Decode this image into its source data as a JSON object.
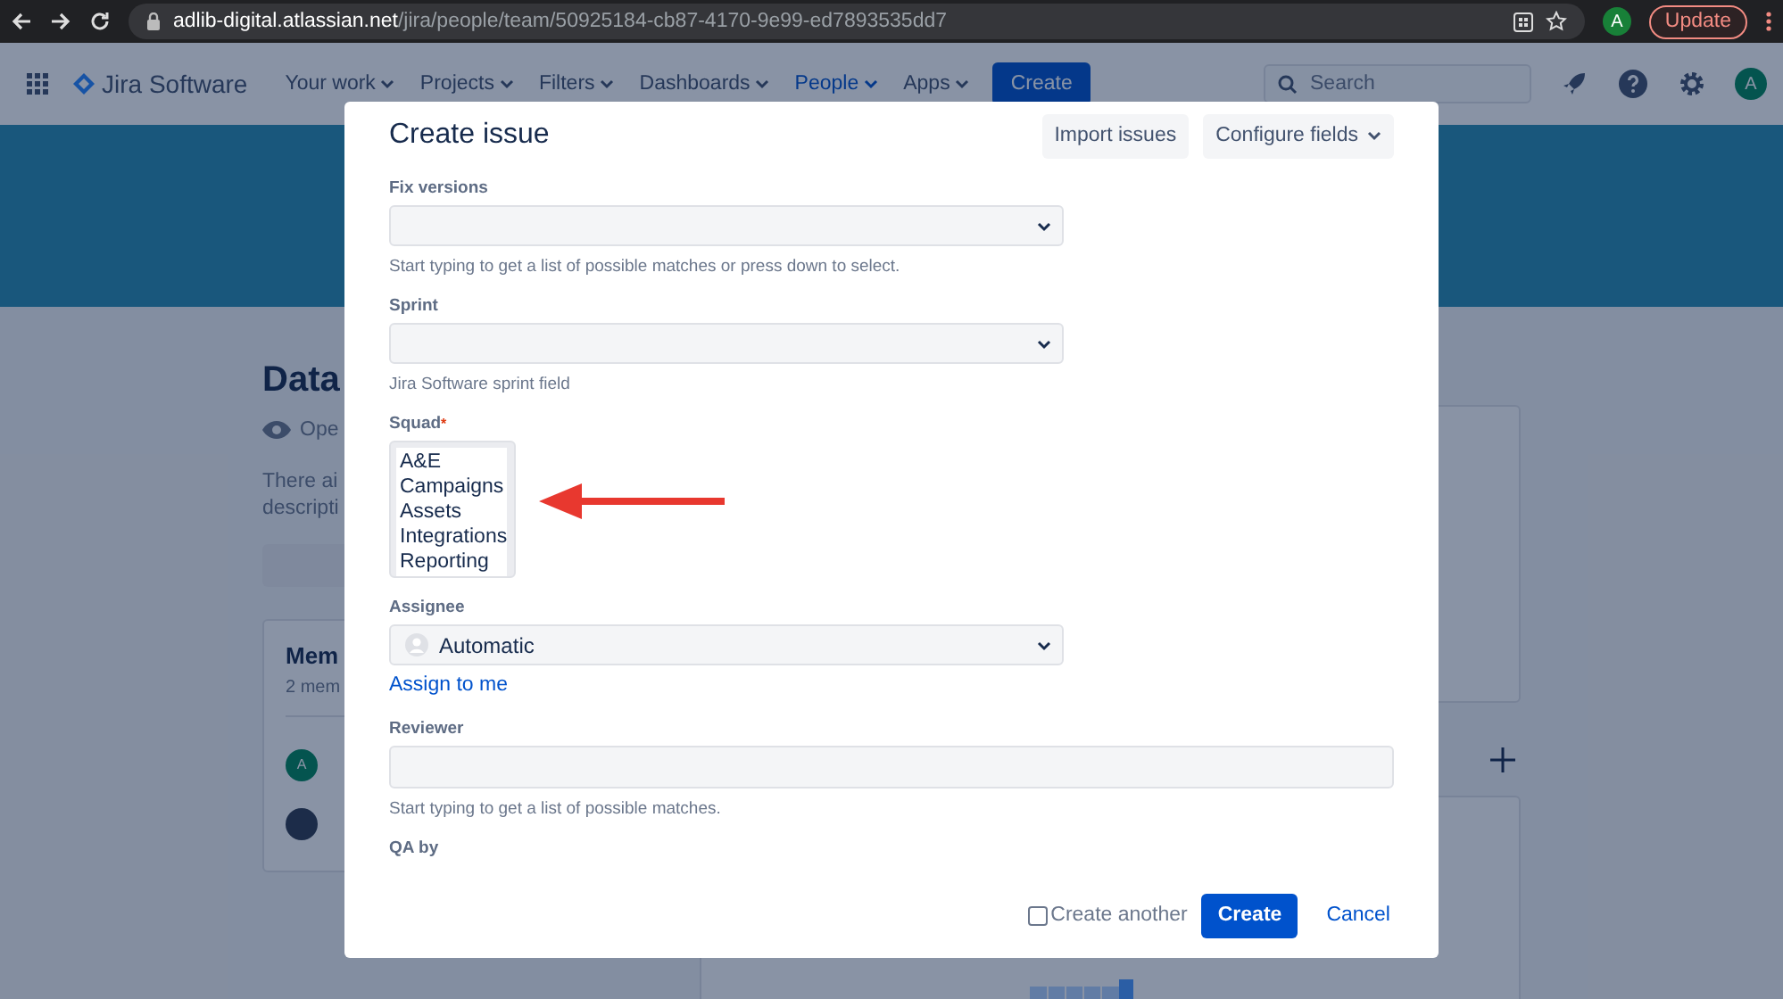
{
  "browser": {
    "url_host": "adlib-digital.atlassian.net",
    "url_path": "/jira/people/team/50925184-cb87-4170-9e99-ed7893535dd7",
    "profile": "A",
    "update_button": "Update"
  },
  "nav": {
    "product": "Jira Software",
    "items": [
      {
        "label": "Your work",
        "selected": false
      },
      {
        "label": "Projects",
        "selected": false
      },
      {
        "label": "Filters",
        "selected": false
      },
      {
        "label": "Dashboards",
        "selected": false
      },
      {
        "label": "People",
        "selected": true
      },
      {
        "label": "Apps",
        "selected": false
      }
    ],
    "create_button": "Create",
    "search": {
      "placeholder": "Search"
    },
    "avatar": "A"
  },
  "background_page": {
    "title": "Data",
    "status": "Ope",
    "description_lines": [
      "There ai",
      "descripti"
    ],
    "members_card": {
      "title": "Mem",
      "count": "2 mem",
      "members": [
        {
          "kind": "letter",
          "avatar": "A"
        },
        {
          "kind": "photo"
        }
      ]
    }
  },
  "dialog": {
    "title": "Create issue",
    "header_buttons": [
      {
        "label": "Import issues",
        "dropdown": false
      },
      {
        "label": "Configure fields",
        "dropdown": true
      }
    ],
    "fields": [
      {
        "kind": "select",
        "label": "Fix versions",
        "hint": "Start typing to get a list of possible matches or press down to select."
      },
      {
        "kind": "select",
        "label": "Sprint",
        "hint": "Jira Software sprint field"
      },
      {
        "kind": "listbox",
        "label": "Squad",
        "required_mark": "*",
        "options": [
          {
            "label": "A&E",
            "selected": false
          },
          {
            "label": "Campaigns",
            "selected": false
          },
          {
            "label": "Assets",
            "selected": false
          },
          {
            "label": "Integrations",
            "selected": false
          },
          {
            "label": "Reporting",
            "selected": false
          }
        ]
      },
      {
        "kind": "select",
        "label": "Assignee",
        "value": "Automatic",
        "user_icon": true,
        "link": "Assign to me"
      },
      {
        "kind": "text",
        "label": "Reviewer",
        "hint": "Start typing to get a list of possible matches."
      },
      {
        "kind": "label",
        "label": "QA by"
      }
    ],
    "create_another": {
      "label": "Create another",
      "checked": false
    },
    "submit_button": "Create",
    "cancel_link": "Cancel"
  },
  "annotation": {
    "kind": "arrow"
  }
}
